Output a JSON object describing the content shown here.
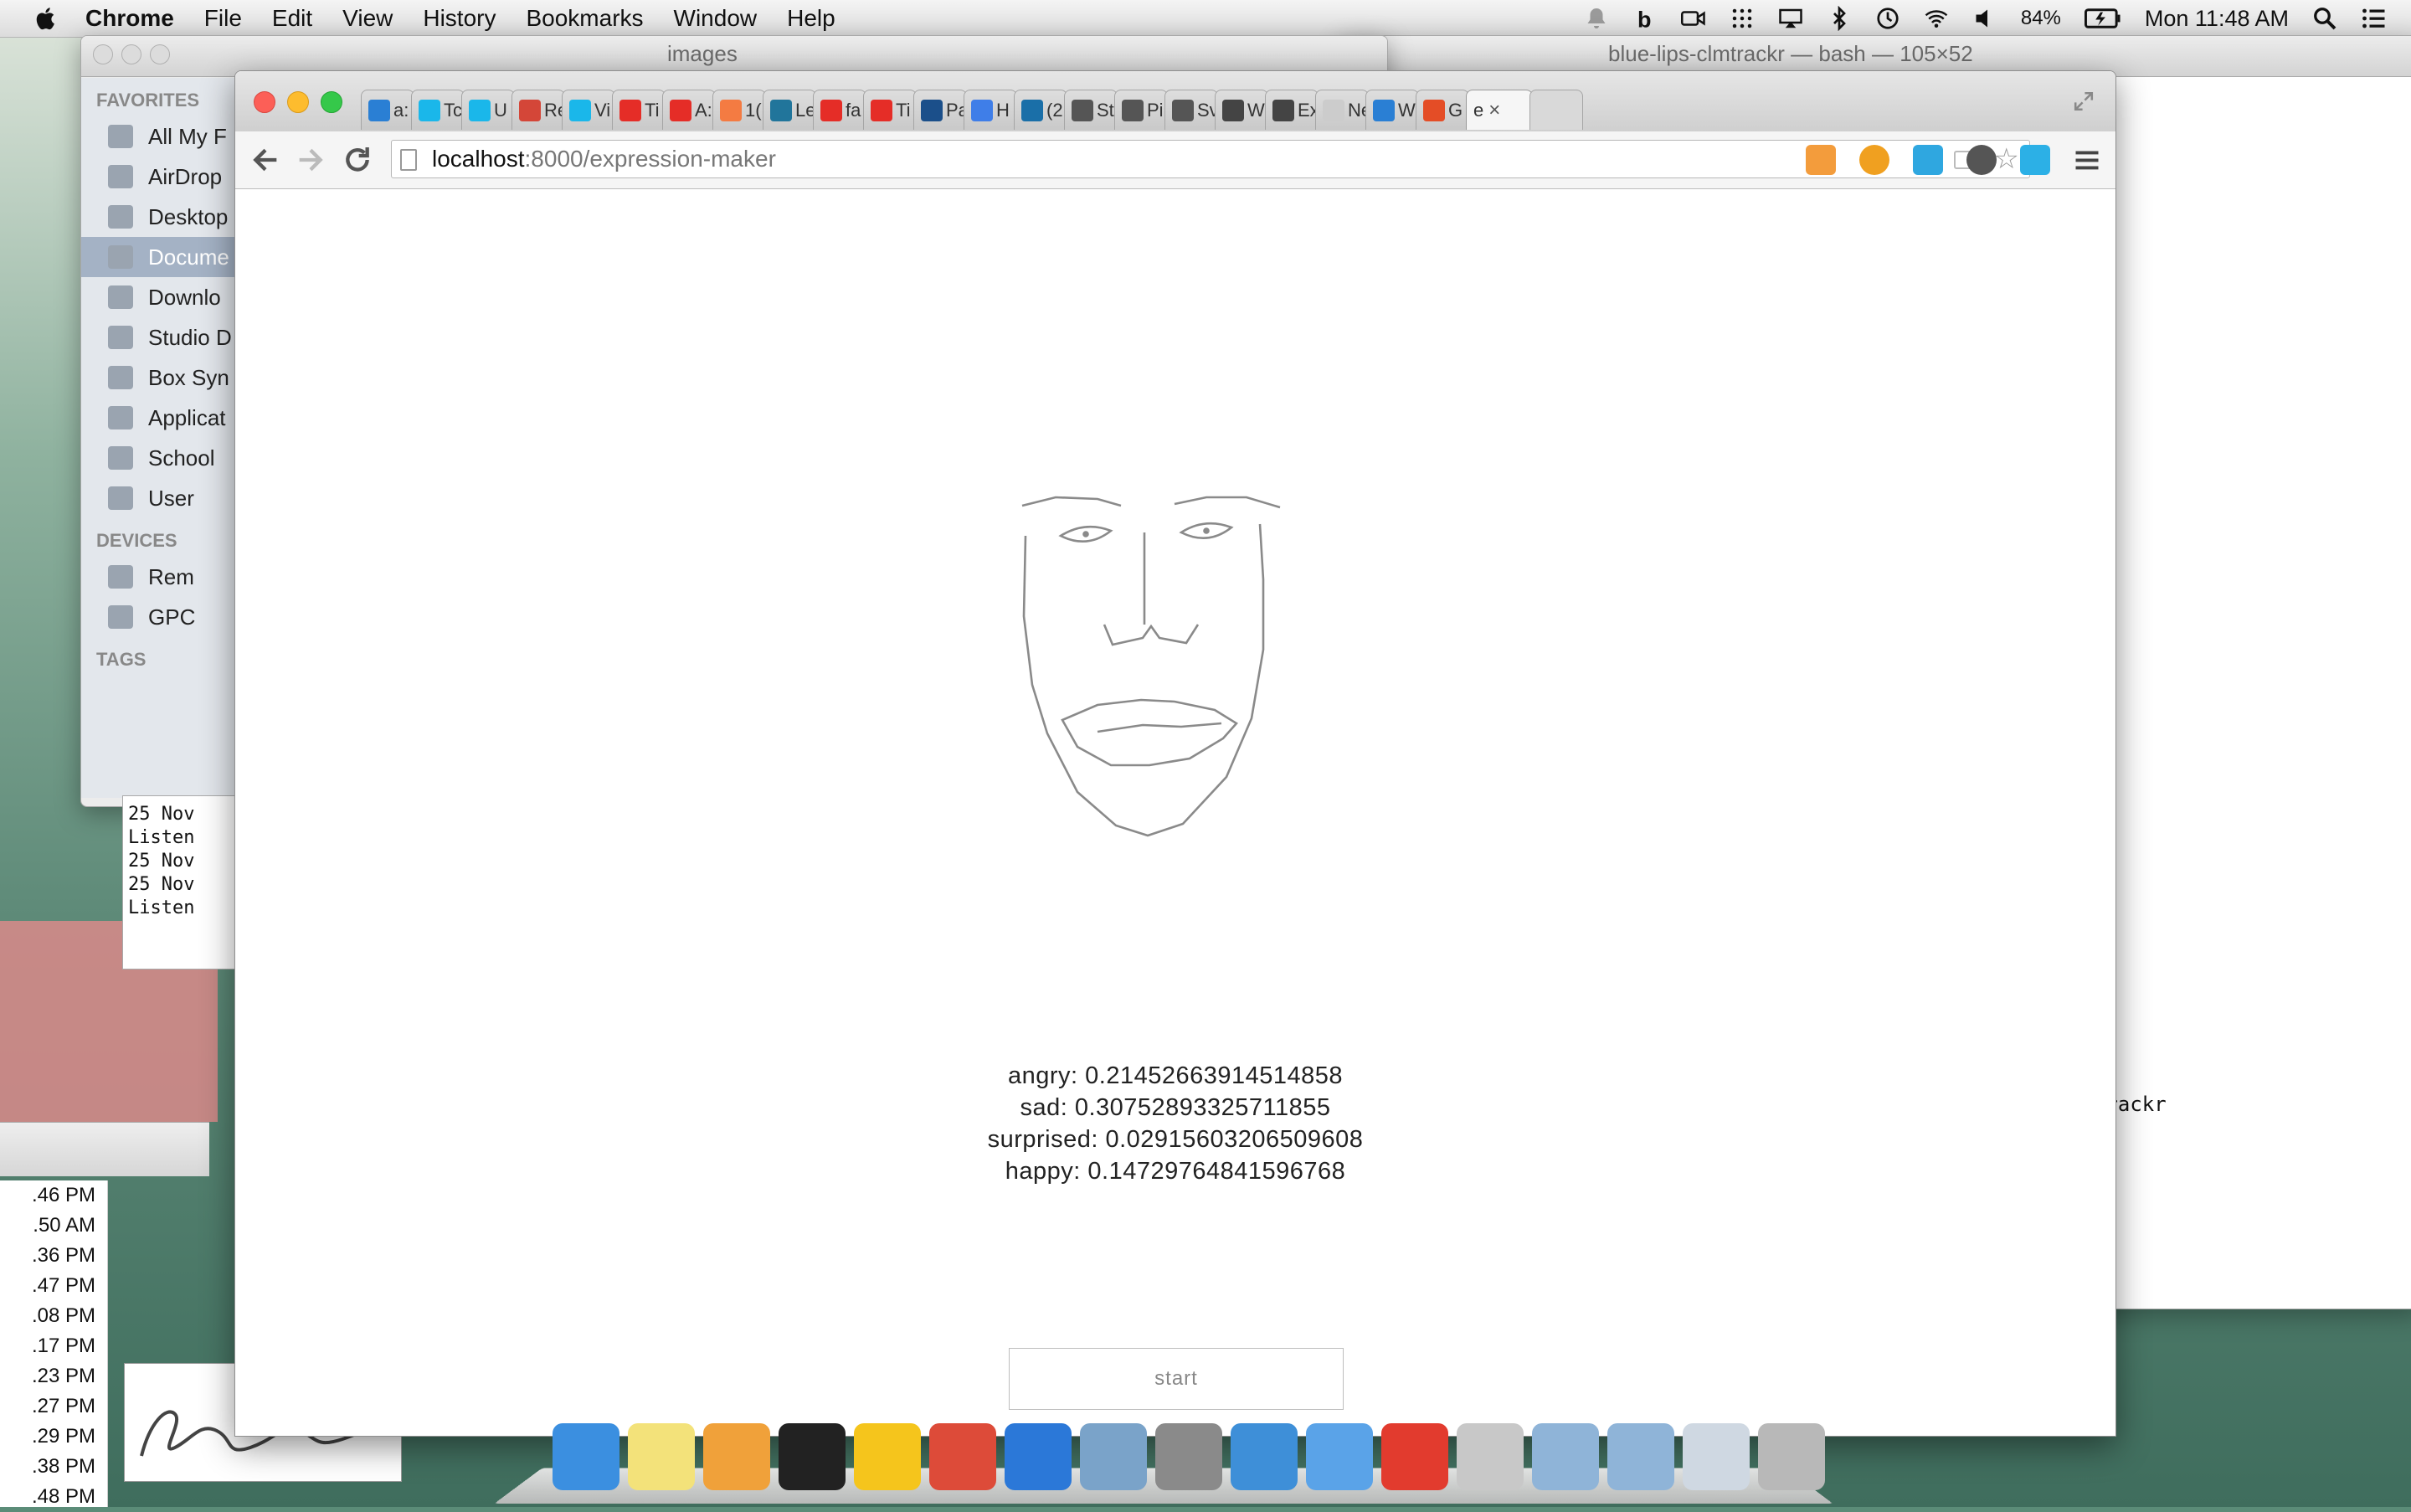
{
  "menubar": {
    "app": "Chrome",
    "items": [
      "File",
      "Edit",
      "View",
      "History",
      "Bookmarks",
      "Window",
      "Help"
    ],
    "battery": "84%",
    "clock": "Mon 11:48 AM"
  },
  "finder": {
    "title": "images",
    "favorites_header": "FAVORITES",
    "favorites": [
      "All My F",
      "AirDrop",
      "Desktop",
      "Docume",
      "Downlo",
      "Studio D",
      "Box Syn",
      "Applicat",
      "School",
      "User"
    ],
    "devices_header": "DEVICES",
    "devices": [
      "Rem",
      "GPC"
    ],
    "tags_header": "TAGS"
  },
  "terminal": {
    "title": "blue-lips-clmtrackr — bash — 105×52",
    "snippet": "trackr",
    "left_lines": [
      "25 Nov",
      "Listen",
      "25 Nov",
      "25 Nov",
      "Listen"
    ]
  },
  "file_times": [
    ".46 PM",
    ".50 AM",
    ".36 PM",
    ".47 PM",
    ".08 PM",
    ".17 PM",
    ".23 PM",
    ".27 PM",
    ".29 PM",
    ".38 PM",
    ".48 PM"
  ],
  "chrome": {
    "tabs": [
      {
        "label": "a: ht",
        "color": "#2a7fd4"
      },
      {
        "label": "Tc",
        "color": "#1ab7ea"
      },
      {
        "label": "U",
        "color": "#1ab7ea"
      },
      {
        "label": "Re",
        "color": "#d44638"
      },
      {
        "label": "Vi",
        "color": "#1ab7ea"
      },
      {
        "label": "Ti",
        "color": "#e52d27"
      },
      {
        "label": "A:",
        "color": "#e52d27"
      },
      {
        "label": "1(",
        "color": "#f47b42"
      },
      {
        "label": "Le",
        "color": "#21759b"
      },
      {
        "label": "fa",
        "color": "#e52d27"
      },
      {
        "label": "Ti",
        "color": "#e52d27"
      },
      {
        "label": "Pa",
        "color": "#1b4f8a"
      },
      {
        "label": "H",
        "color": "#3f7ee8"
      },
      {
        "label": "(2",
        "color": "#1a6fa8"
      },
      {
        "label": "St",
        "color": "#555555"
      },
      {
        "label": "Pi",
        "color": "#555555"
      },
      {
        "label": "Sv",
        "color": "#555555"
      },
      {
        "label": "W",
        "color": "#444444"
      },
      {
        "label": "Ex",
        "color": "#444444"
      },
      {
        "label": "New",
        "color": "#cccccc"
      },
      {
        "label": "W",
        "color": "#2a7fd4"
      },
      {
        "label": "G",
        "color": "#e44d26"
      }
    ],
    "active_tab": "e",
    "url_host": "localhost",
    "url_rest": ":8000/expression-maker"
  },
  "page": {
    "emotions": [
      {
        "label": "angry: 0.21452663914514858"
      },
      {
        "label": "sad: 0.30752893325711855"
      },
      {
        "label": "surprised: 0.02915603206509608"
      },
      {
        "label": "happy: 0.14729764841596768"
      }
    ],
    "start_button": "start"
  },
  "dock": {
    "apps": [
      {
        "name": "Finder",
        "color": "#3b8fe0"
      },
      {
        "name": "Stickies",
        "color": "#f3e27a"
      },
      {
        "name": "Pages",
        "color": "#f0a13a"
      },
      {
        "name": "Terminal",
        "color": "#222222"
      },
      {
        "name": "Fetch",
        "color": "#f5c51c"
      },
      {
        "name": "Chrome",
        "color": "#dd4b39"
      },
      {
        "name": "Word",
        "color": "#2b78d8"
      },
      {
        "name": "Preview",
        "color": "#7aa3c9"
      },
      {
        "name": "System Preferences",
        "color": "#8a8a8a"
      },
      {
        "name": "Xcode",
        "color": "#3e8fd8"
      },
      {
        "name": "iOS Simulator",
        "color": "#5aa3e8"
      },
      {
        "name": "Acrobat",
        "color": "#e23b2e"
      },
      {
        "name": "Disk Utility",
        "color": "#c8c8c8"
      },
      {
        "name": "Folder",
        "color": "#8fb4d8"
      },
      {
        "name": "Folder",
        "color": "#8fb4d8"
      },
      {
        "name": "Screenshot",
        "color": "#cfd8e2"
      },
      {
        "name": "Trash",
        "color": "#b8b8b8"
      }
    ]
  }
}
